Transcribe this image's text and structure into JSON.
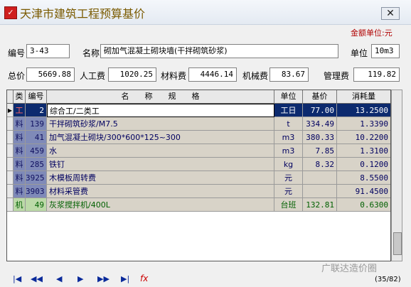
{
  "window": {
    "title": "天津市建筑工程预算基价",
    "close_glyph": "✕",
    "icon_glyph": "✓"
  },
  "unit_note": "金额单位:元",
  "header": {
    "code_label": "编号",
    "code_value": "3-43",
    "name_label": "名称",
    "name_value": "砌加气混凝土砌块墙(干拌砌筑砂浆)",
    "unit_label": "单位",
    "unit_value": "10m3"
  },
  "totals": {
    "total_label": "总价",
    "total_value": "5669.88",
    "labor_label": "人工费",
    "labor_value": "1020.25",
    "material_label": "材料费",
    "material_value": "4446.14",
    "machine_label": "机械费",
    "machine_value": "83.67",
    "mgmt_label": "管理费",
    "mgmt_value": "119.82"
  },
  "table": {
    "columns": {
      "type": "类",
      "code": "编号",
      "name": "名　　称　　规　　格",
      "unit": "单位",
      "base": "基价",
      "cons": "消耗量"
    },
    "rows": [
      {
        "type": "工",
        "code": "2",
        "name": "综合工/二类工",
        "unit": "工日",
        "base": "77.00",
        "cons": "13.2500"
      },
      {
        "type": "料",
        "code": "139",
        "name": "干拌砌筑砂浆/M7.5",
        "unit": "t",
        "base": "334.49",
        "cons": "1.3390"
      },
      {
        "type": "料",
        "code": "41",
        "name": "加气混凝土砌块/300*600*125~300",
        "unit": "m3",
        "base": "380.33",
        "cons": "10.2200"
      },
      {
        "type": "料",
        "code": "459",
        "name": "水",
        "unit": "m3",
        "base": "7.85",
        "cons": "1.3100"
      },
      {
        "type": "料",
        "code": "285",
        "name": "铁钉",
        "unit": "kg",
        "base": "8.32",
        "cons": "0.1200"
      },
      {
        "type": "料",
        "code": "3925",
        "name": "木模板周转费",
        "unit": "元",
        "base": "",
        "cons": "8.5500"
      },
      {
        "type": "料",
        "code": "3903",
        "name": "材料采管费",
        "unit": "元",
        "base": "",
        "cons": "91.4500"
      },
      {
        "type": "机",
        "code": "49",
        "name": "灰浆搅拌机/400L",
        "unit": "台班",
        "base": "132.81",
        "cons": "0.6300"
      }
    ]
  },
  "nav": {
    "first": "|◀",
    "prev_page": "◀◀",
    "prev": "◀",
    "next": "▶",
    "next_page": "▶▶",
    "last": "▶|",
    "fx": "fx"
  },
  "record_counter": "(35/82)",
  "watermark": "广联达造价圈"
}
